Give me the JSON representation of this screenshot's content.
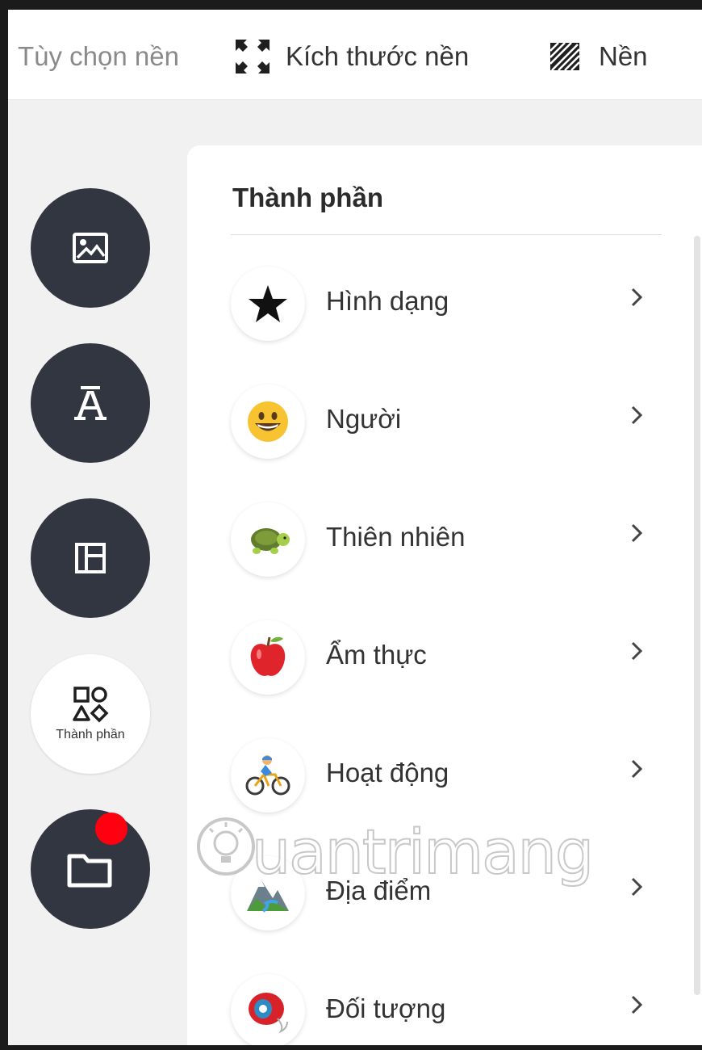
{
  "toolbar": {
    "background_options_label": "Tùy chọn nền",
    "background_size_label": "Kích thước nền",
    "background_label": "Nền"
  },
  "rail": {
    "items": [
      {
        "icon": "image-icon"
      },
      {
        "icon": "text-icon"
      },
      {
        "icon": "layout-icon"
      },
      {
        "icon": "shapes-icon",
        "label": "Thành phần"
      },
      {
        "icon": "folder-icon"
      }
    ]
  },
  "panel": {
    "title": "Thành phần",
    "categories": [
      {
        "label": "Hình dạng",
        "icon": "star-icon"
      },
      {
        "label": "Người",
        "icon": "smiley-icon"
      },
      {
        "label": "Thiên nhiên",
        "icon": "turtle-icon"
      },
      {
        "label": "Ẩm thực",
        "icon": "apple-icon"
      },
      {
        "label": "Hoạt động",
        "icon": "cyclist-icon"
      },
      {
        "label": "Địa điểm",
        "icon": "mountain-icon"
      },
      {
        "label": "Đối tượng",
        "icon": "yoyo-icon"
      }
    ]
  },
  "watermark": {
    "text": "uantrimang"
  },
  "colors": {
    "rail_dark": "#323640",
    "notification": "#ff0010",
    "panel_bg": "#ffffff",
    "page_bg": "#f1f1f1"
  }
}
